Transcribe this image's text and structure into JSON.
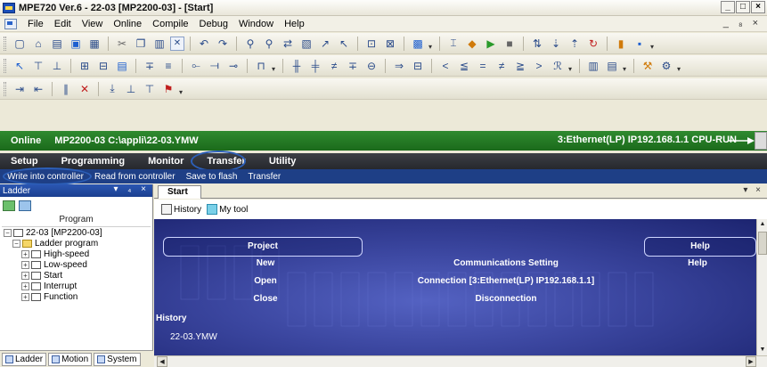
{
  "window": {
    "title": "MPE720 Ver.6 - 22-03 [MP2200-03] - [Start]",
    "controls": [
      "_",
      "□",
      "×"
    ]
  },
  "menu": {
    "items": [
      "File",
      "Edit",
      "View",
      "Online",
      "Compile",
      "Debug",
      "Window",
      "Help"
    ],
    "mdi_controls": "_ ₈ ×"
  },
  "status": {
    "online": "Online",
    "path": "MP2200-03 C:\\appli\\22-03.YMW",
    "connection": "3:Ethernet(LP) IP192.168.1.1 CPU-RUN"
  },
  "ribbon": {
    "tabs": [
      "Setup",
      "Programming",
      "Monitor",
      "Transfer",
      "Utility"
    ],
    "active_tab": "Transfer",
    "commands": [
      "Write into controller",
      "Read from controller",
      "Save to flash",
      "Transfer"
    ]
  },
  "left_panel": {
    "title": "Ladder",
    "controls": "▾ ₄ ×",
    "tree_header": "Program",
    "tree": [
      {
        "label": "22-03 [MP2200-03]",
        "expander": "−",
        "level": 0,
        "icon": "device"
      },
      {
        "label": "Ladder program",
        "expander": "−",
        "level": 1,
        "icon": "folder"
      },
      {
        "label": "High-speed",
        "expander": "+",
        "level": 2,
        "icon": "doc"
      },
      {
        "label": "Low-speed",
        "expander": "+",
        "level": 2,
        "icon": "doc"
      },
      {
        "label": "Start",
        "expander": "+",
        "level": 2,
        "icon": "doc"
      },
      {
        "label": "Interrupt",
        "expander": "+",
        "level": 2,
        "icon": "doc"
      },
      {
        "label": "Function",
        "expander": "+",
        "level": 2,
        "icon": "doc"
      }
    ],
    "bottom_tabs": [
      "Ladder",
      "Motion",
      "System"
    ]
  },
  "document": {
    "tab": "Start",
    "tab_controls": "▾ ×",
    "toolbar": [
      "History",
      "My tool"
    ]
  },
  "start_page": {
    "sections": {
      "project": "Project",
      "help": "Help",
      "history": "History"
    },
    "project_links": [
      "New",
      "Open",
      "Close"
    ],
    "comm_links": [
      "Communications Setting",
      "Connection [3:Ethernet(LP) IP192.168.1.1]",
      "Disconnection"
    ],
    "help_link": "Help",
    "history_items": [
      "22-03.YMW"
    ]
  },
  "colors": {
    "status_green": "#1f7a1f",
    "ribbon_dark": "#2d3036",
    "ribbon_blue": "#1e3f86",
    "panel_blue": "#1b3f8f",
    "start_bg": "#3a459e",
    "highlight_oval": "#2c5fb8"
  },
  "icons": {
    "toolbar1": [
      "new-icon",
      "open-icon",
      "save-icon",
      "save-all-icon",
      "print-icon",
      "cut-icon",
      "copy-icon",
      "paste-icon",
      "compile-icon",
      "undo-icon",
      "redo-icon",
      "find-icon",
      "replace-icon",
      "monitor-icon",
      "online-icon",
      "run-icon",
      "stop-icon",
      "transfer-icon",
      "lock-icon"
    ],
    "toolbar2": [
      "contact-no-icon",
      "contact-nc-icon",
      "coil-icon",
      "compare-icon",
      "math-icon"
    ],
    "toolbar3": [
      "indent-icon",
      "comment-icon",
      "format-icon",
      "insert-icon"
    ]
  }
}
